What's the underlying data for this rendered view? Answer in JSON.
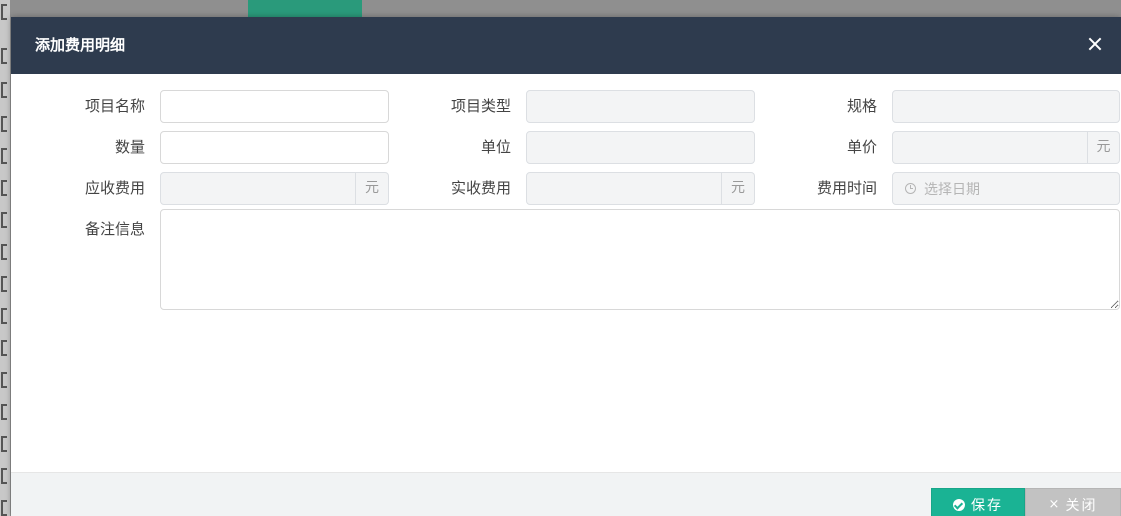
{
  "modal": {
    "title": "添加费用明细",
    "colors": {
      "header_bg": "#2e3b4e",
      "save_bg": "#1ab394",
      "close_bg": "#c2c2c2"
    }
  },
  "form": {
    "item_name": {
      "label": "项目名称",
      "value": ""
    },
    "item_type": {
      "label": "项目类型",
      "value": ""
    },
    "spec": {
      "label": "规格",
      "value": ""
    },
    "quantity": {
      "label": "数量",
      "value": ""
    },
    "unit": {
      "label": "单位",
      "value": ""
    },
    "unit_price": {
      "label": "单价",
      "value": "",
      "addon": "元"
    },
    "receivable_fee": {
      "label": "应收费用",
      "value": "",
      "addon": "元"
    },
    "actual_fee": {
      "label": "实收费用",
      "value": "",
      "addon": "元"
    },
    "fee_time": {
      "label": "费用时间",
      "placeholder": "选择日期"
    },
    "remarks": {
      "label": "备注信息",
      "value": ""
    }
  },
  "footer": {
    "save_label": "保存",
    "close_label": "关闭",
    "times_glyph": "×"
  }
}
